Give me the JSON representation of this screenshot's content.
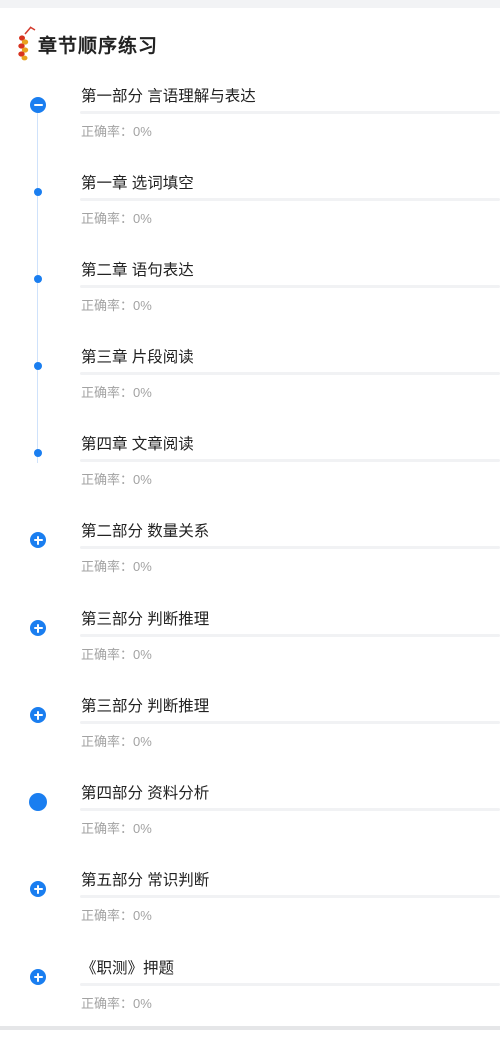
{
  "header": {
    "title": "章节顺序练习"
  },
  "colors": {
    "accent": "#1a7ef0",
    "text": "#222222",
    "muted": "#a3a3a3"
  },
  "sections": [
    {
      "name": "第一部分 言语理解与表达",
      "accuracy": "正确率：0%",
      "progress": 0,
      "marker": "minus-circle"
    },
    {
      "name": "第一章 选词填空",
      "accuracy": "正确率：0%",
      "progress": 0,
      "marker": "dot"
    },
    {
      "name": "第二章 语句表达",
      "accuracy": "正确率：0%",
      "progress": 0,
      "marker": "dot"
    },
    {
      "name": "第三章 片段阅读",
      "accuracy": "正确率：0%",
      "progress": 0,
      "marker": "dot"
    },
    {
      "name": "第四章 文章阅读",
      "accuracy": "正确率：0%",
      "progress": 0,
      "marker": "dot"
    },
    {
      "name": "第二部分 数量关系",
      "accuracy": "正确率：0%",
      "progress": 0,
      "marker": "plus-circle"
    },
    {
      "name": "第三部分 判断推理",
      "accuracy": "正确率：0%",
      "progress": 0,
      "marker": "plus-circle"
    },
    {
      "name": "第三部分 判断推理",
      "accuracy": "正确率：0%",
      "progress": 0,
      "marker": "plus-circle"
    },
    {
      "name": "第四部分 资料分析",
      "accuracy": "正确率：0%",
      "progress": 0,
      "marker": "filled-circle"
    },
    {
      "name": "第五部分 常识判断",
      "accuracy": "正确率：0%",
      "progress": 0,
      "marker": "plus-circle"
    },
    {
      "name": "《职测》押题",
      "accuracy": "正确率：0%",
      "progress": 0,
      "marker": "plus-circle"
    }
  ]
}
